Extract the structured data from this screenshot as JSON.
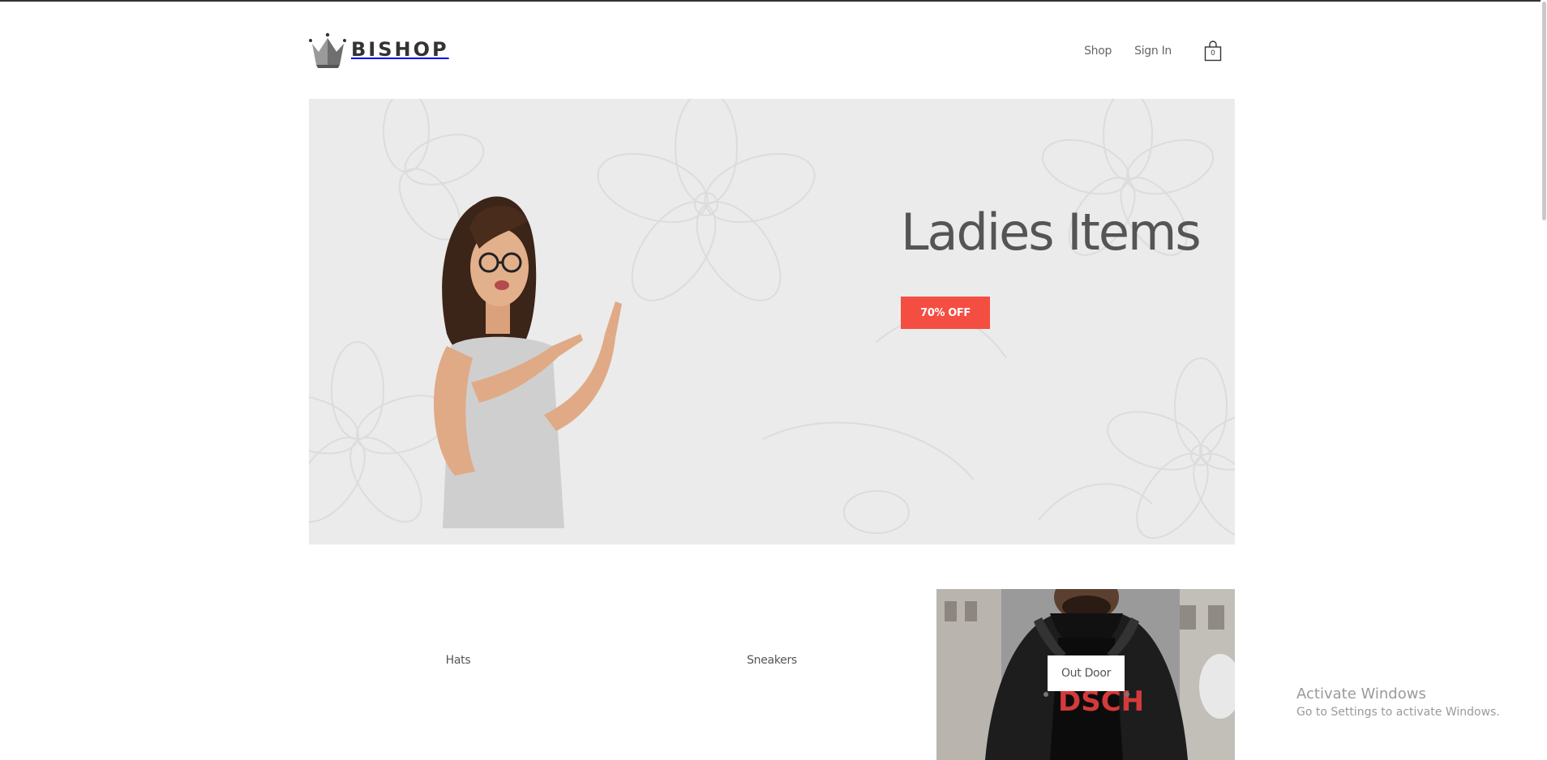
{
  "brand": {
    "name": "BISHOP"
  },
  "nav": {
    "shop": "Shop",
    "sign_in": "Sign In",
    "cart_count": "0"
  },
  "hero": {
    "title": "Ladies Items",
    "button": "70% OFF",
    "button_color": "#f44e43",
    "background_color": "#ebebeb"
  },
  "categories": [
    {
      "label": "Hats"
    },
    {
      "label": "Sneakers"
    },
    {
      "label": "Out Door"
    }
  ],
  "watermark": {
    "title": "Activate Windows",
    "subtitle": "Go to Settings to activate Windows."
  }
}
